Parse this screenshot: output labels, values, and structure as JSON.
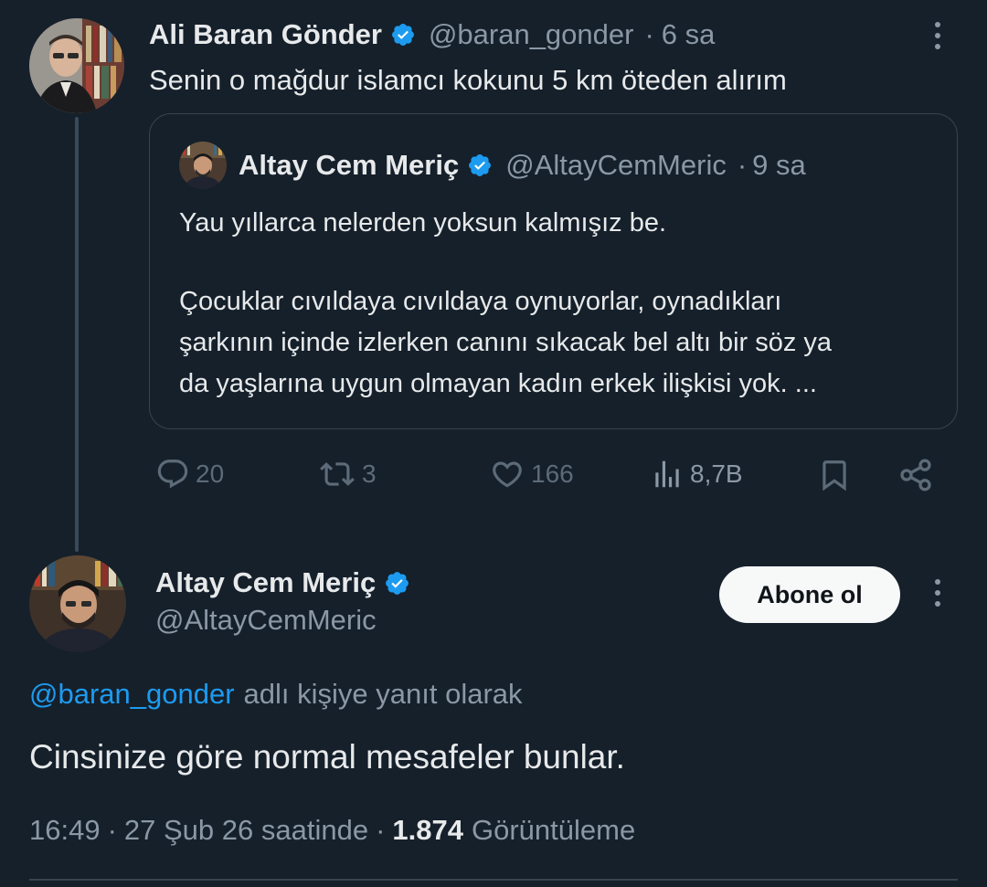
{
  "reply_tweet": {
    "author_name": "Ali Baran Gönder",
    "handle": "@baran_gonder",
    "separator": "·",
    "time_ago": "6 sa",
    "text": "Senin o mağdur islamcı kokunu 5 km öteden alırım",
    "quoted": {
      "author_name": "Altay Cem Meriç",
      "handle": "@AltayCemMeric",
      "separator": "·",
      "time_ago": "9 sa",
      "line1": "Yau yıllarca nelerden yoksun kalmışız be.",
      "line2": "Çocuklar cıvıldaya cıvıldaya oynuyorlar, oynadıkları",
      "line3": "şarkının içinde izlerken canını sıkacak bel altı bir söz ya",
      "line4": "da yaşlarına uygun olmayan kadın erkek ilişkisi yok. ..."
    },
    "actions": {
      "replies": "20",
      "retweets": "3",
      "likes": "166",
      "views": "8,7B"
    }
  },
  "main_tweet": {
    "author_name": "Altay Cem Meriç",
    "handle": "@AltayCemMeric",
    "follow_label": "Abone ol",
    "reply_to_handle": "@baran_gonder",
    "reply_to_suffix": "adlı kişiye yanıt olarak",
    "text": "Cinsinize göre normal mesafeler bunlar.",
    "time": "16:49",
    "sep1": "·",
    "date": "27 Şub 26 saatinde",
    "sep2": "·",
    "view_count": "1.874",
    "view_label": "Görüntüleme"
  },
  "colors": {
    "background": "#15202b",
    "accent": "#1d9bf0",
    "muted": "#8b98a5"
  },
  "icons": [
    "verified-badge-icon",
    "more-icon",
    "reply-icon",
    "retweet-icon",
    "like-icon",
    "views-icon",
    "bookmark-icon",
    "share-icon"
  ]
}
